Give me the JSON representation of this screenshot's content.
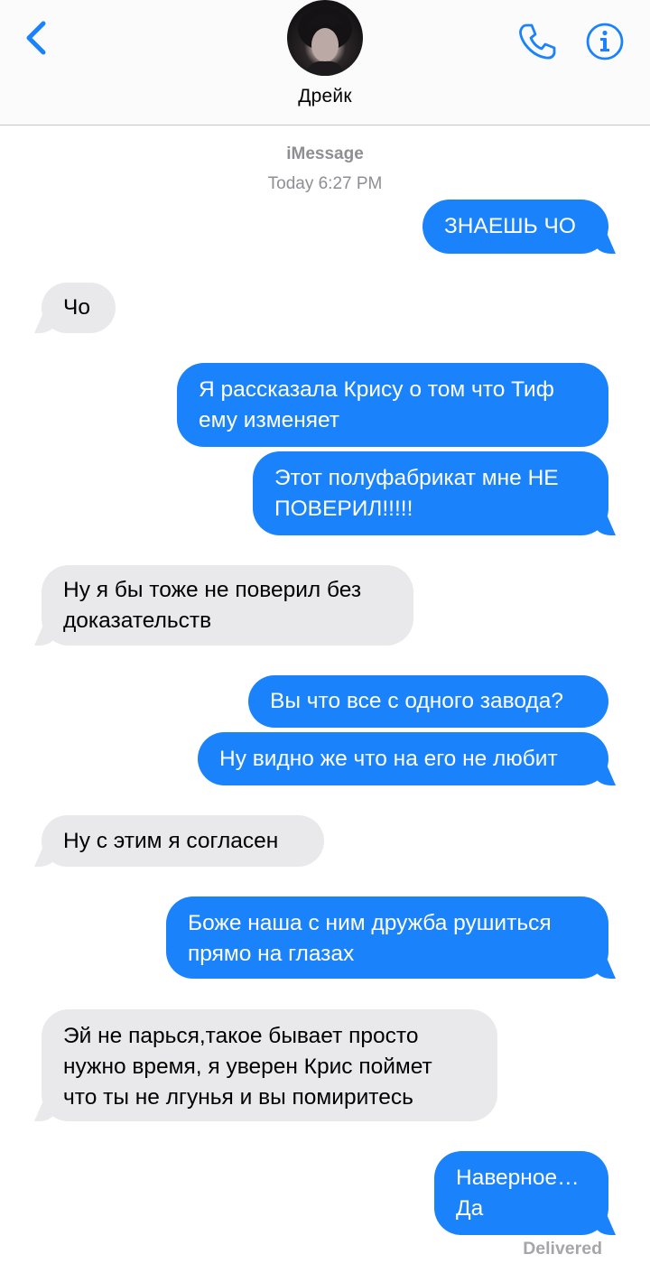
{
  "header": {
    "contact_name": "Дрейк",
    "icons": {
      "back": "chevron-left-icon",
      "call": "phone-icon",
      "info": "info-icon"
    },
    "accent_color": "#1a82fb"
  },
  "thread": {
    "service": "iMessage",
    "timestamp": "Today 6:27 PM"
  },
  "messages": [
    {
      "direction": "outgoing",
      "text": "ЗНАЕШЬ ЧО"
    },
    {
      "direction": "incoming",
      "text": "Чо"
    },
    {
      "direction": "outgoing",
      "text": "Я рассказала Крису о том что Тиф\nему изменяет"
    },
    {
      "direction": "outgoing",
      "text": "Этот полуфабрикат мне НЕ\nПОВЕРИЛ!!!!!"
    },
    {
      "direction": "incoming",
      "text": "Ну я бы тоже не поверил без\nдоказательств"
    },
    {
      "direction": "outgoing",
      "text": "Вы что все с одного завода?"
    },
    {
      "direction": "outgoing",
      "text": "Ну видно же что на его не любит"
    },
    {
      "direction": "incoming",
      "text": "Ну с этим я согласен"
    },
    {
      "direction": "outgoing",
      "text": "Боже наша с ним дружба рушиться\nпрямо на глазах"
    },
    {
      "direction": "incoming",
      "text": "Эй не парься,такое бывает просто\nнужно время, я уверен Крис поймет\nчто ты не лгунья и вы помиритесь"
    },
    {
      "direction": "outgoing",
      "text": "Наверное…\nДа"
    }
  ],
  "status": {
    "delivered": "Delivered"
  },
  "colors": {
    "outgoing_bubble": "#1a82fb",
    "incoming_bubble": "#e9e9eb",
    "meta_text": "#8e8e93"
  }
}
